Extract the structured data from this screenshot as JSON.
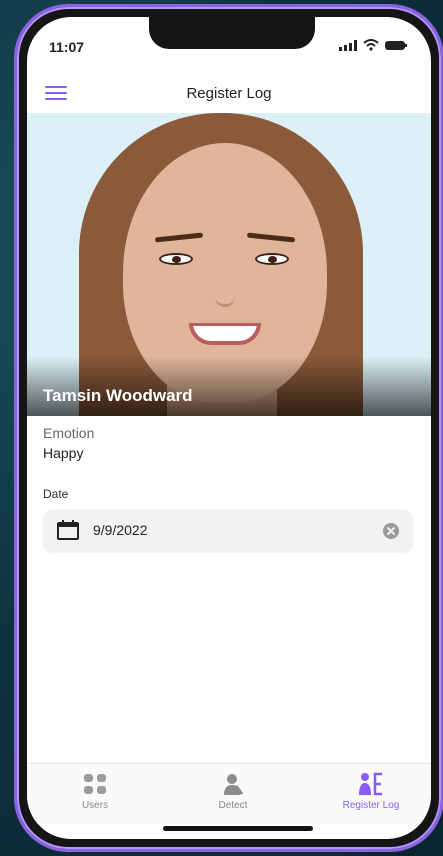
{
  "status": {
    "time": "11:07"
  },
  "appbar": {
    "title": "Register Log"
  },
  "profile": {
    "name": "Tamsin Woodward"
  },
  "emotion": {
    "label": "Emotion",
    "value": "Happy"
  },
  "date": {
    "label": "Date",
    "value": "9/9/2022"
  },
  "nav": {
    "items": [
      {
        "label": "Users",
        "icon": "grid-icon"
      },
      {
        "label": "Detect",
        "icon": "person-detect-icon"
      },
      {
        "label": "Register Log",
        "icon": "register-log-icon"
      }
    ],
    "active": "Register Log"
  },
  "colors": {
    "accent": "#8a5cf6",
    "frame": "#8a63e0"
  }
}
